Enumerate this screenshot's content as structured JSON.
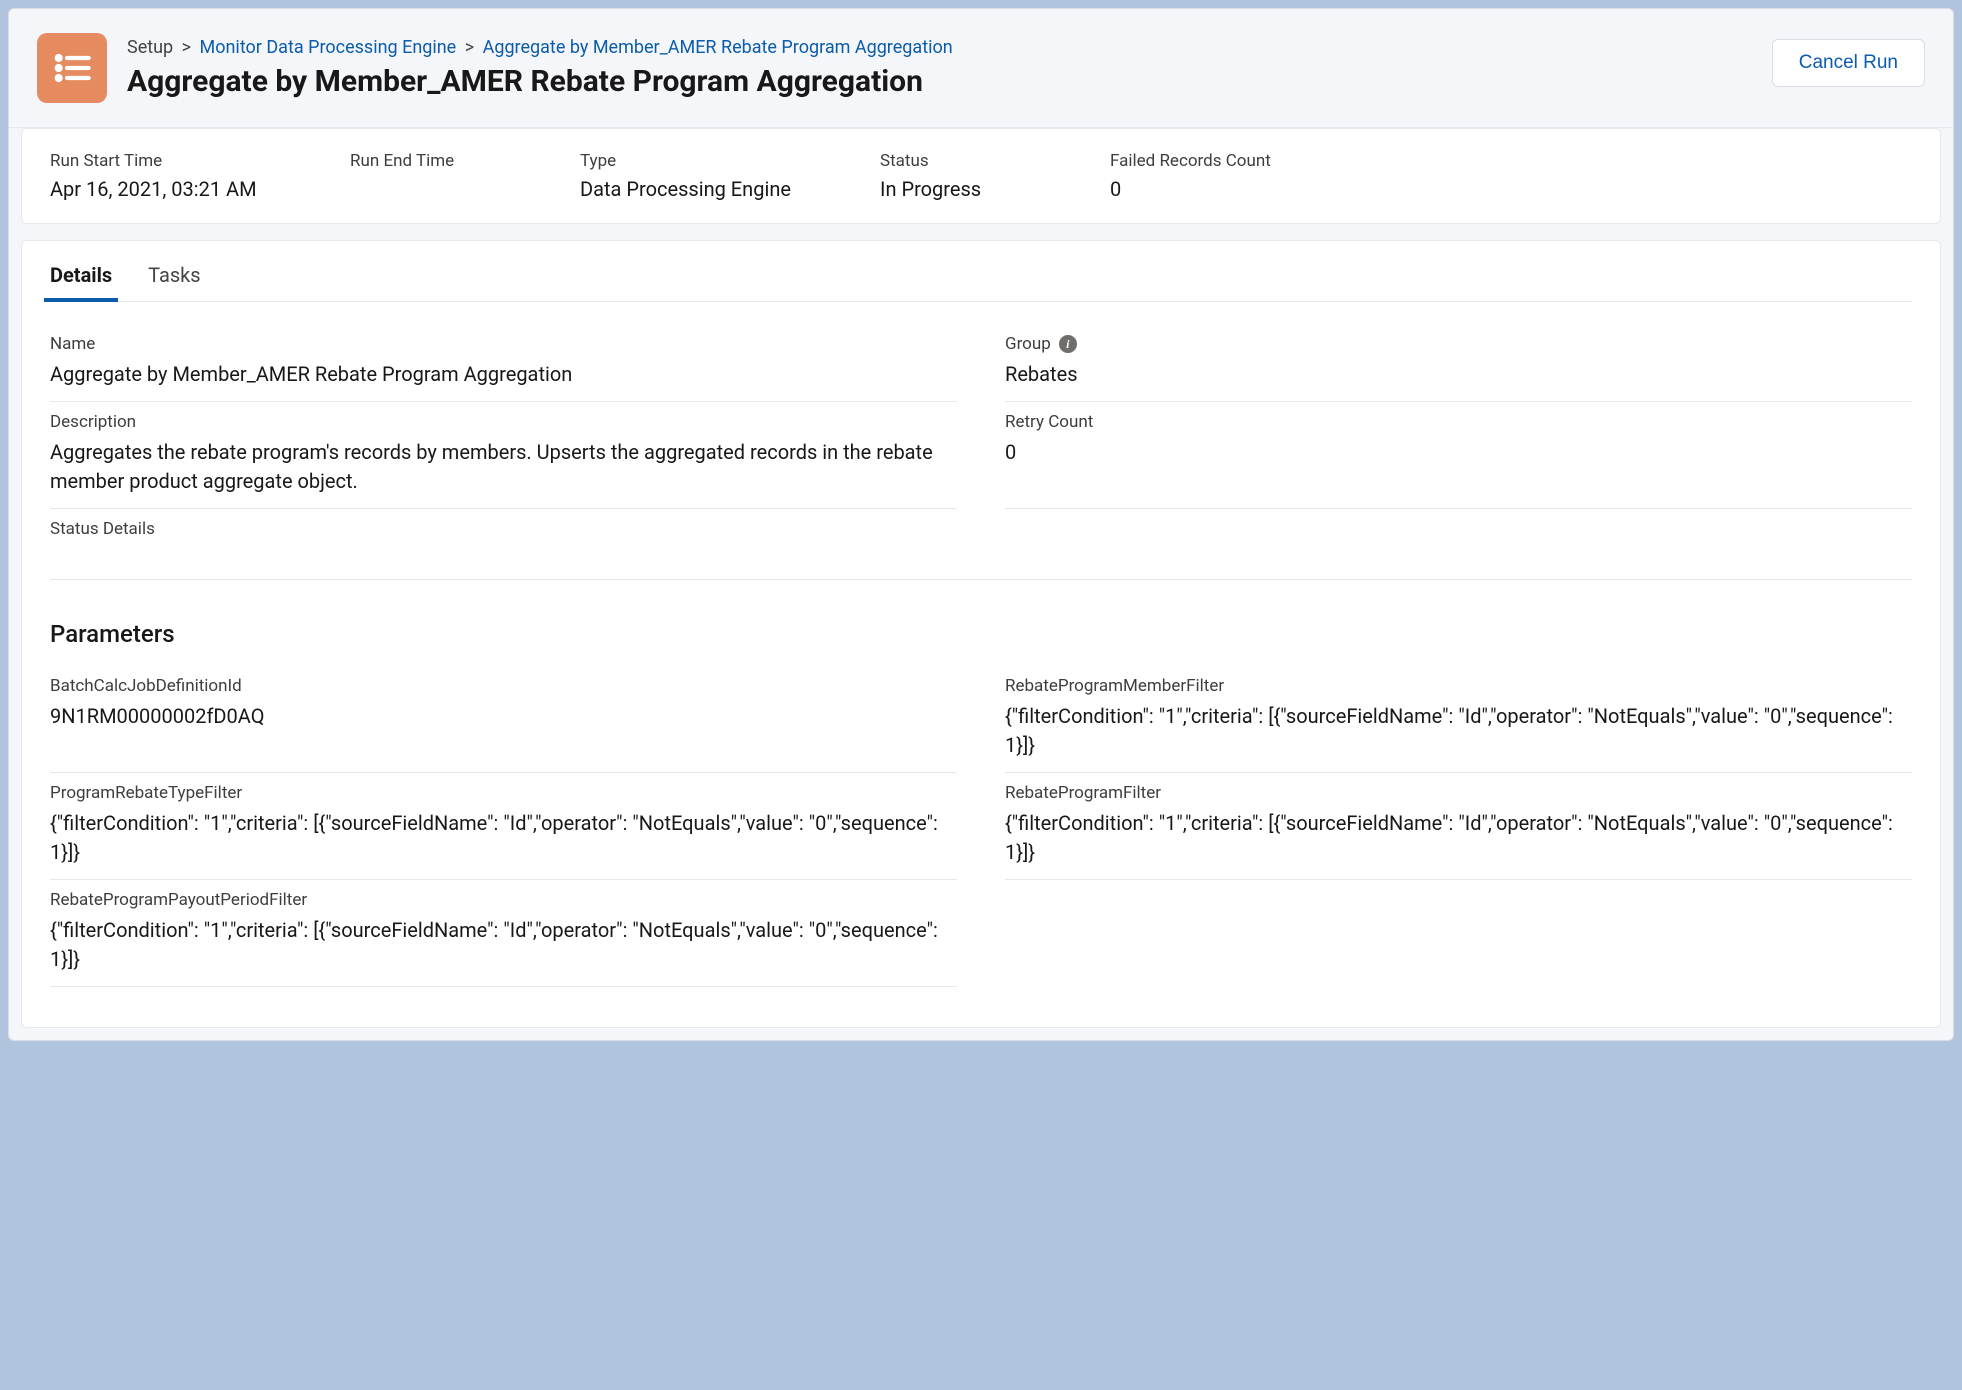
{
  "breadcrumb": {
    "root": "Setup",
    "mid": "Monitor Data Processing Engine",
    "leaf": "Aggregate by Member_AMER Rebate Program Aggregation"
  },
  "page_title": "Aggregate by Member_AMER Rebate Program Aggregation",
  "cancel_label": "Cancel Run",
  "summary": {
    "run_start_label": "Run Start Time",
    "run_start_value": "Apr 16, 2021, 03:21 AM",
    "run_end_label": "Run End Time",
    "run_end_value": "",
    "type_label": "Type",
    "type_value": "Data Processing Engine",
    "status_label": "Status",
    "status_value": "In Progress",
    "failed_label": "Failed Records Count",
    "failed_value": "0"
  },
  "tabs": {
    "details": "Details",
    "tasks": "Tasks"
  },
  "fields": {
    "name_label": "Name",
    "name_value": "Aggregate by Member_AMER Rebate Program Aggregation",
    "group_label": "Group",
    "group_value": "Rebates",
    "description_label": "Description",
    "description_value": "Aggregates the rebate program's records by members. Upserts the aggregated records in the rebate member product aggregate object.",
    "retry_label": "Retry Count",
    "retry_value": "0",
    "status_details_label": "Status Details",
    "status_details_value": ""
  },
  "parameters_heading": "Parameters",
  "params": {
    "batch_label": "BatchCalcJobDefinitionId",
    "batch_value": "9N1RM00000002fD0AQ",
    "member_filter_label": "RebateProgramMemberFilter",
    "member_filter_value": "{\"filterCondition\": \"1\",\"criteria\": [{\"sourceFieldName\": \"Id\",\"operator\": \"NotEquals\",\"value\": \"0\",\"sequence\": 1}]}",
    "type_filter_label": "ProgramRebateTypeFilter",
    "type_filter_value": "{\"filterCondition\": \"1\",\"criteria\": [{\"sourceFieldName\": \"Id\",\"operator\": \"NotEquals\",\"value\": \"0\",\"sequence\": 1}]}",
    "program_filter_label": "RebateProgramFilter",
    "program_filter_value": "{\"filterCondition\": \"1\",\"criteria\": [{\"sourceFieldName\": \"Id\",\"operator\": \"NotEquals\",\"value\": \"0\",\"sequence\": 1}]}",
    "payout_filter_label": "RebateProgramPayoutPeriodFilter",
    "payout_filter_value": "{\"filterCondition\": \"1\",\"criteria\": [{\"sourceFieldName\": \"Id\",\"operator\": \"NotEquals\",\"value\": \"0\",\"sequence\": 1}]}"
  }
}
